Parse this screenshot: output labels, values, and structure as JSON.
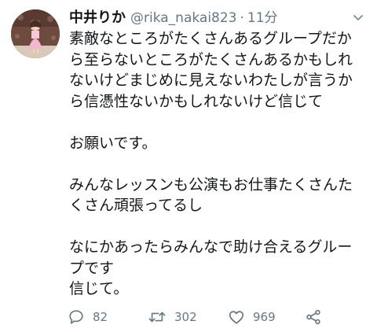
{
  "user": {
    "display_name": "中井りか",
    "handle": "@rika_nakai823",
    "separator": "·",
    "time": "11分"
  },
  "tweet": {
    "paragraphs": [
      [
        "素敵なところがたくさんあるグループだか",
        "ら至らないところがたくさんあるかもしれ",
        "ないけどまじめに見えないわたしが言うか",
        "ら信憑性ないかもしれないけど信じて"
      ],
      [
        "お願いです。"
      ],
      [
        "みんなレッスンも公演もお仕事たくさんた",
        "くさん頑張ってるし"
      ],
      [
        "なにかあったらみんなで助け合えるグルー",
        "プです",
        "信じて。"
      ]
    ]
  },
  "actions": {
    "reply_count": "82",
    "retweet_count": "302",
    "like_count": "969"
  },
  "icons": {
    "reply": "reply-icon",
    "retweet": "retweet-icon",
    "like": "heart-icon",
    "share": "share-icon",
    "menu": "chevron-down-icon"
  },
  "colors": {
    "text": "#14171a",
    "secondary": "#657786"
  }
}
